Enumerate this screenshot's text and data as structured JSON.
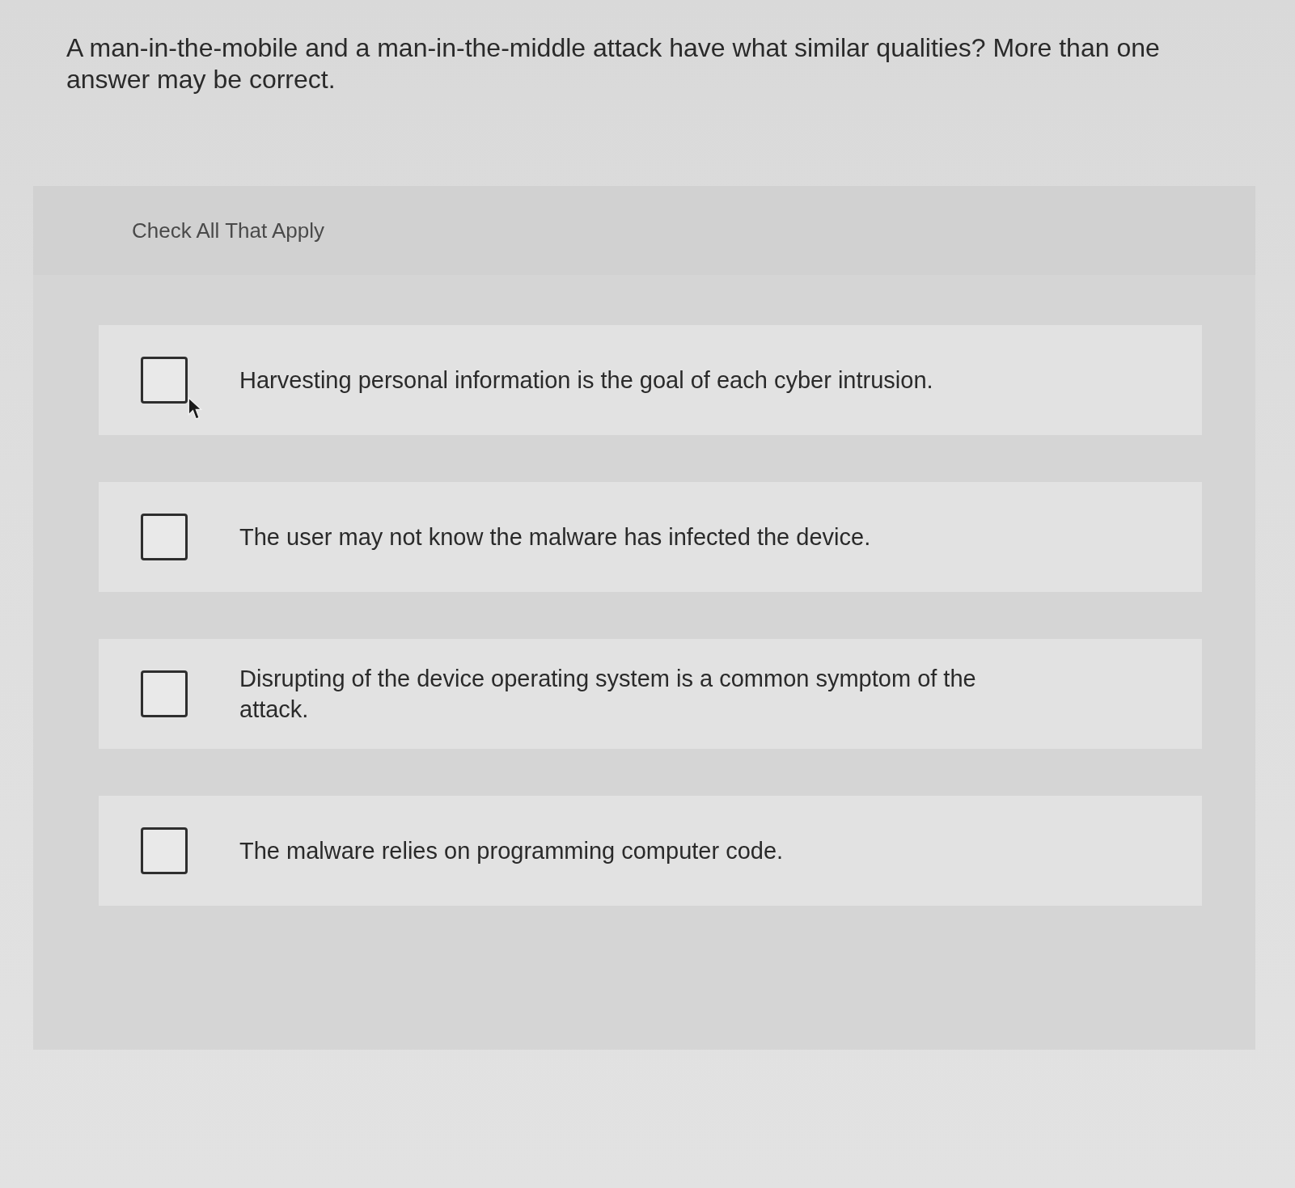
{
  "question": "A man-in-the-mobile and a man-in-the-middle attack have what similar qualities? More than one answer may be correct.",
  "panel": {
    "instruction": "Check All That Apply",
    "options": [
      {
        "label": "Harvesting personal information is the goal of each cyber intrusion.",
        "checked": false
      },
      {
        "label": "The user may not know the malware has infected the device.",
        "checked": false
      },
      {
        "label": "Disrupting of the device operating system is a common symptom of the attack.",
        "checked": false
      },
      {
        "label": "The malware relies on programming computer code.",
        "checked": false
      }
    ]
  }
}
